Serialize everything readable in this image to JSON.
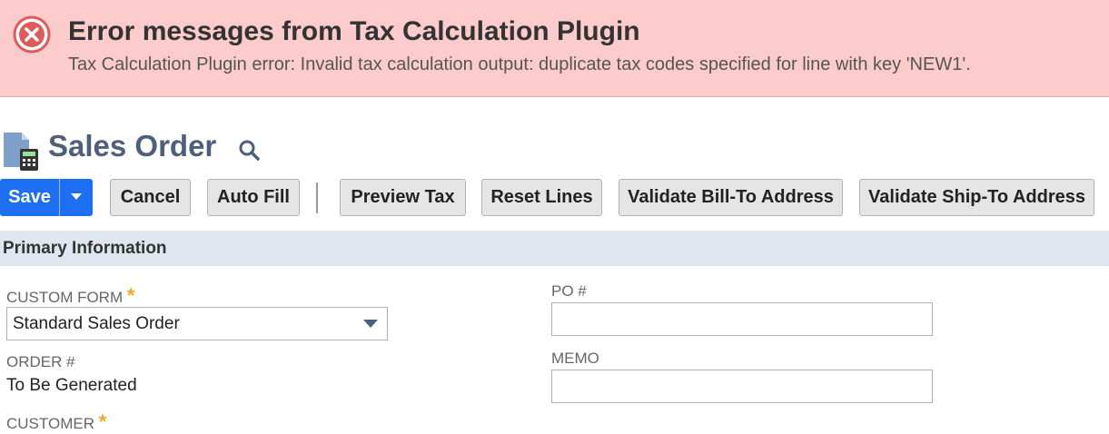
{
  "error_banner": {
    "title": "Error messages from Tax Calculation Plugin",
    "detail": "Tax Calculation Plugin error: Invalid tax calculation output: duplicate tax codes specified for line with key 'NEW1'.",
    "icon": "error-x-icon",
    "background_color": "#fccccc",
    "icon_color": "#e05a5a"
  },
  "header": {
    "title": "Sales Order",
    "doc_icon": "document-calculator-icon",
    "search_icon": "search-icon",
    "title_color": "#4d5f79"
  },
  "toolbar": {
    "save_label": "Save",
    "cancel_label": "Cancel",
    "autofill_label": "Auto Fill",
    "preview_tax_label": "Preview Tax",
    "reset_lines_label": "Reset Lines",
    "validate_bill_label": "Validate Bill-To Address",
    "validate_ship_label": "Validate Ship-To Address",
    "primary_color": "#1d6ff2"
  },
  "primary_info": {
    "section_title": "Primary Information",
    "custom_form": {
      "label": "CUSTOM FORM",
      "required_marker": "*",
      "value": "Standard Sales Order"
    },
    "order_number": {
      "label": "ORDER #",
      "value": "To Be Generated"
    },
    "customer": {
      "label": "CUSTOMER",
      "required_marker": "*"
    },
    "po_number": {
      "label": "PO #",
      "value": ""
    },
    "memo": {
      "label": "MEMO",
      "value": ""
    }
  }
}
